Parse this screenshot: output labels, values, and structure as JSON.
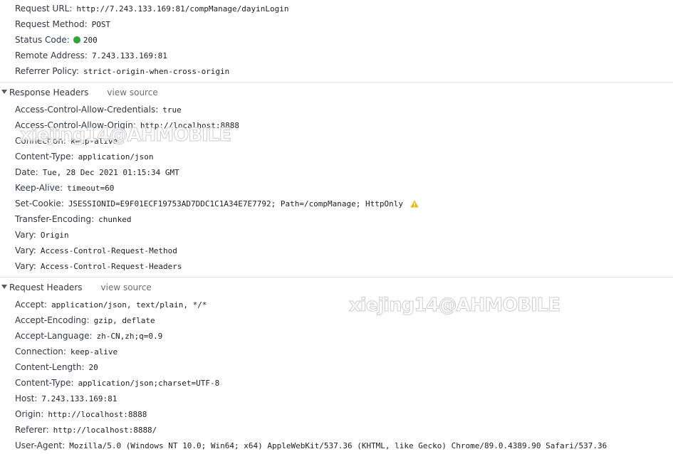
{
  "general": {
    "request_url": {
      "key": "Request URL:",
      "value": "http://7.243.133.169:81/compManage/dayinLogin"
    },
    "request_method": {
      "key": "Request Method:",
      "value": "POST"
    },
    "status_code": {
      "key": "Status Code:",
      "value": "200",
      "status_color": "#2fa83a"
    },
    "remote_address": {
      "key": "Remote Address:",
      "value": "7.243.133.169:81"
    },
    "referrer_policy": {
      "key": "Referrer Policy:",
      "value": "strict-origin-when-cross-origin"
    }
  },
  "response_headers": {
    "title": "Response Headers",
    "view_source": "view source",
    "items": [
      {
        "key": "Access-Control-Allow-Credentials:",
        "value": "true"
      },
      {
        "key": "Access-Control-Allow-Origin:",
        "value": "http://localhost:8888"
      },
      {
        "key": "Connection:",
        "value": "keep-alive"
      },
      {
        "key": "Content-Type:",
        "value": "application/json"
      },
      {
        "key": "Date:",
        "value": "Tue, 28 Dec 2021 01:15:34 GMT"
      },
      {
        "key": "Keep-Alive:",
        "value": "timeout=60"
      },
      {
        "key": "Set-Cookie:",
        "value": "JSESSIONID=E9F01ECF19753AD7DDC1C1A34E7E7792; Path=/compManage; HttpOnly",
        "icon": "warning-icon"
      },
      {
        "key": "Transfer-Encoding:",
        "value": "chunked"
      },
      {
        "key": "Vary:",
        "value": "Origin"
      },
      {
        "key": "Vary:",
        "value": "Access-Control-Request-Method"
      },
      {
        "key": "Vary:",
        "value": "Access-Control-Request-Headers"
      }
    ]
  },
  "request_headers": {
    "title": "Request Headers",
    "view_source": "view source",
    "items": [
      {
        "key": "Accept:",
        "value": "application/json, text/plain, */*"
      },
      {
        "key": "Accept-Encoding:",
        "value": "gzip, deflate"
      },
      {
        "key": "Accept-Language:",
        "value": "zh-CN,zh;q=0.9"
      },
      {
        "key": "Connection:",
        "value": "keep-alive"
      },
      {
        "key": "Content-Length:",
        "value": "20"
      },
      {
        "key": "Content-Type:",
        "value": "application/json;charset=UTF-8"
      },
      {
        "key": "Host:",
        "value": "7.243.133.169:81"
      },
      {
        "key": "Origin:",
        "value": "http://localhost:8888"
      },
      {
        "key": "Referer:",
        "value": "http://localhost:8888/"
      },
      {
        "key": "User-Agent:",
        "value": "Mozilla/5.0 (Windows NT 10.0; Win64; x64) AppleWebKit/537.36 (KHTML, like Gecko) Chrome/89.0.4389.90 Safari/537.36"
      }
    ]
  },
  "watermarks": [
    "xiejing14@AHMOBILE",
    "xiejing14@AHMOBILE"
  ],
  "colors": {
    "warning": "#e8b400",
    "divider": "#e1e1e1"
  }
}
